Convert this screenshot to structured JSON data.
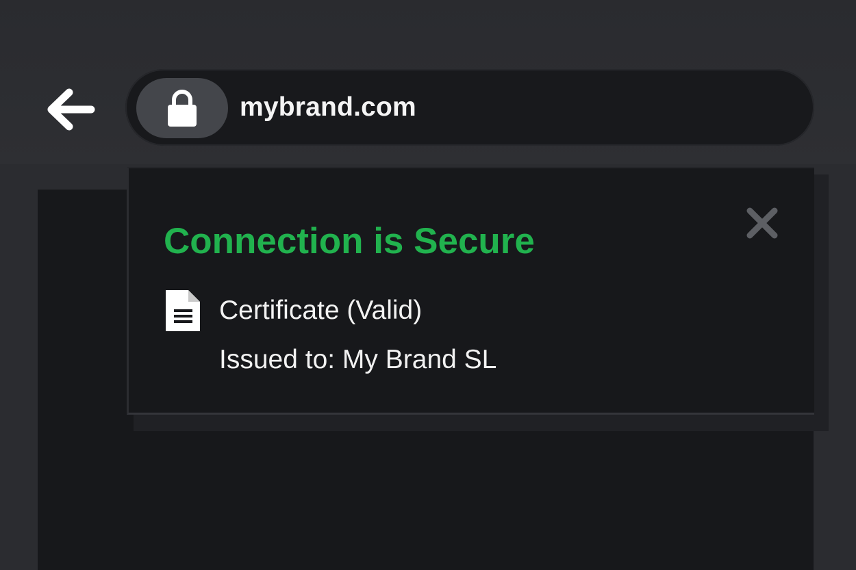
{
  "toolbar": {
    "back_icon": "arrow-left-icon",
    "back_icon_color": "#ffffff"
  },
  "address_bar": {
    "lock_icon": "lock-icon",
    "url": "mybrand.com"
  },
  "security_popup": {
    "title": "Connection is Secure",
    "title_color": "#21b24e",
    "close_icon": "close-icon",
    "certificate_icon": "document-icon",
    "certificate_status": "Certificate (Valid)",
    "issued_to": "Issued to: My Brand SL"
  }
}
